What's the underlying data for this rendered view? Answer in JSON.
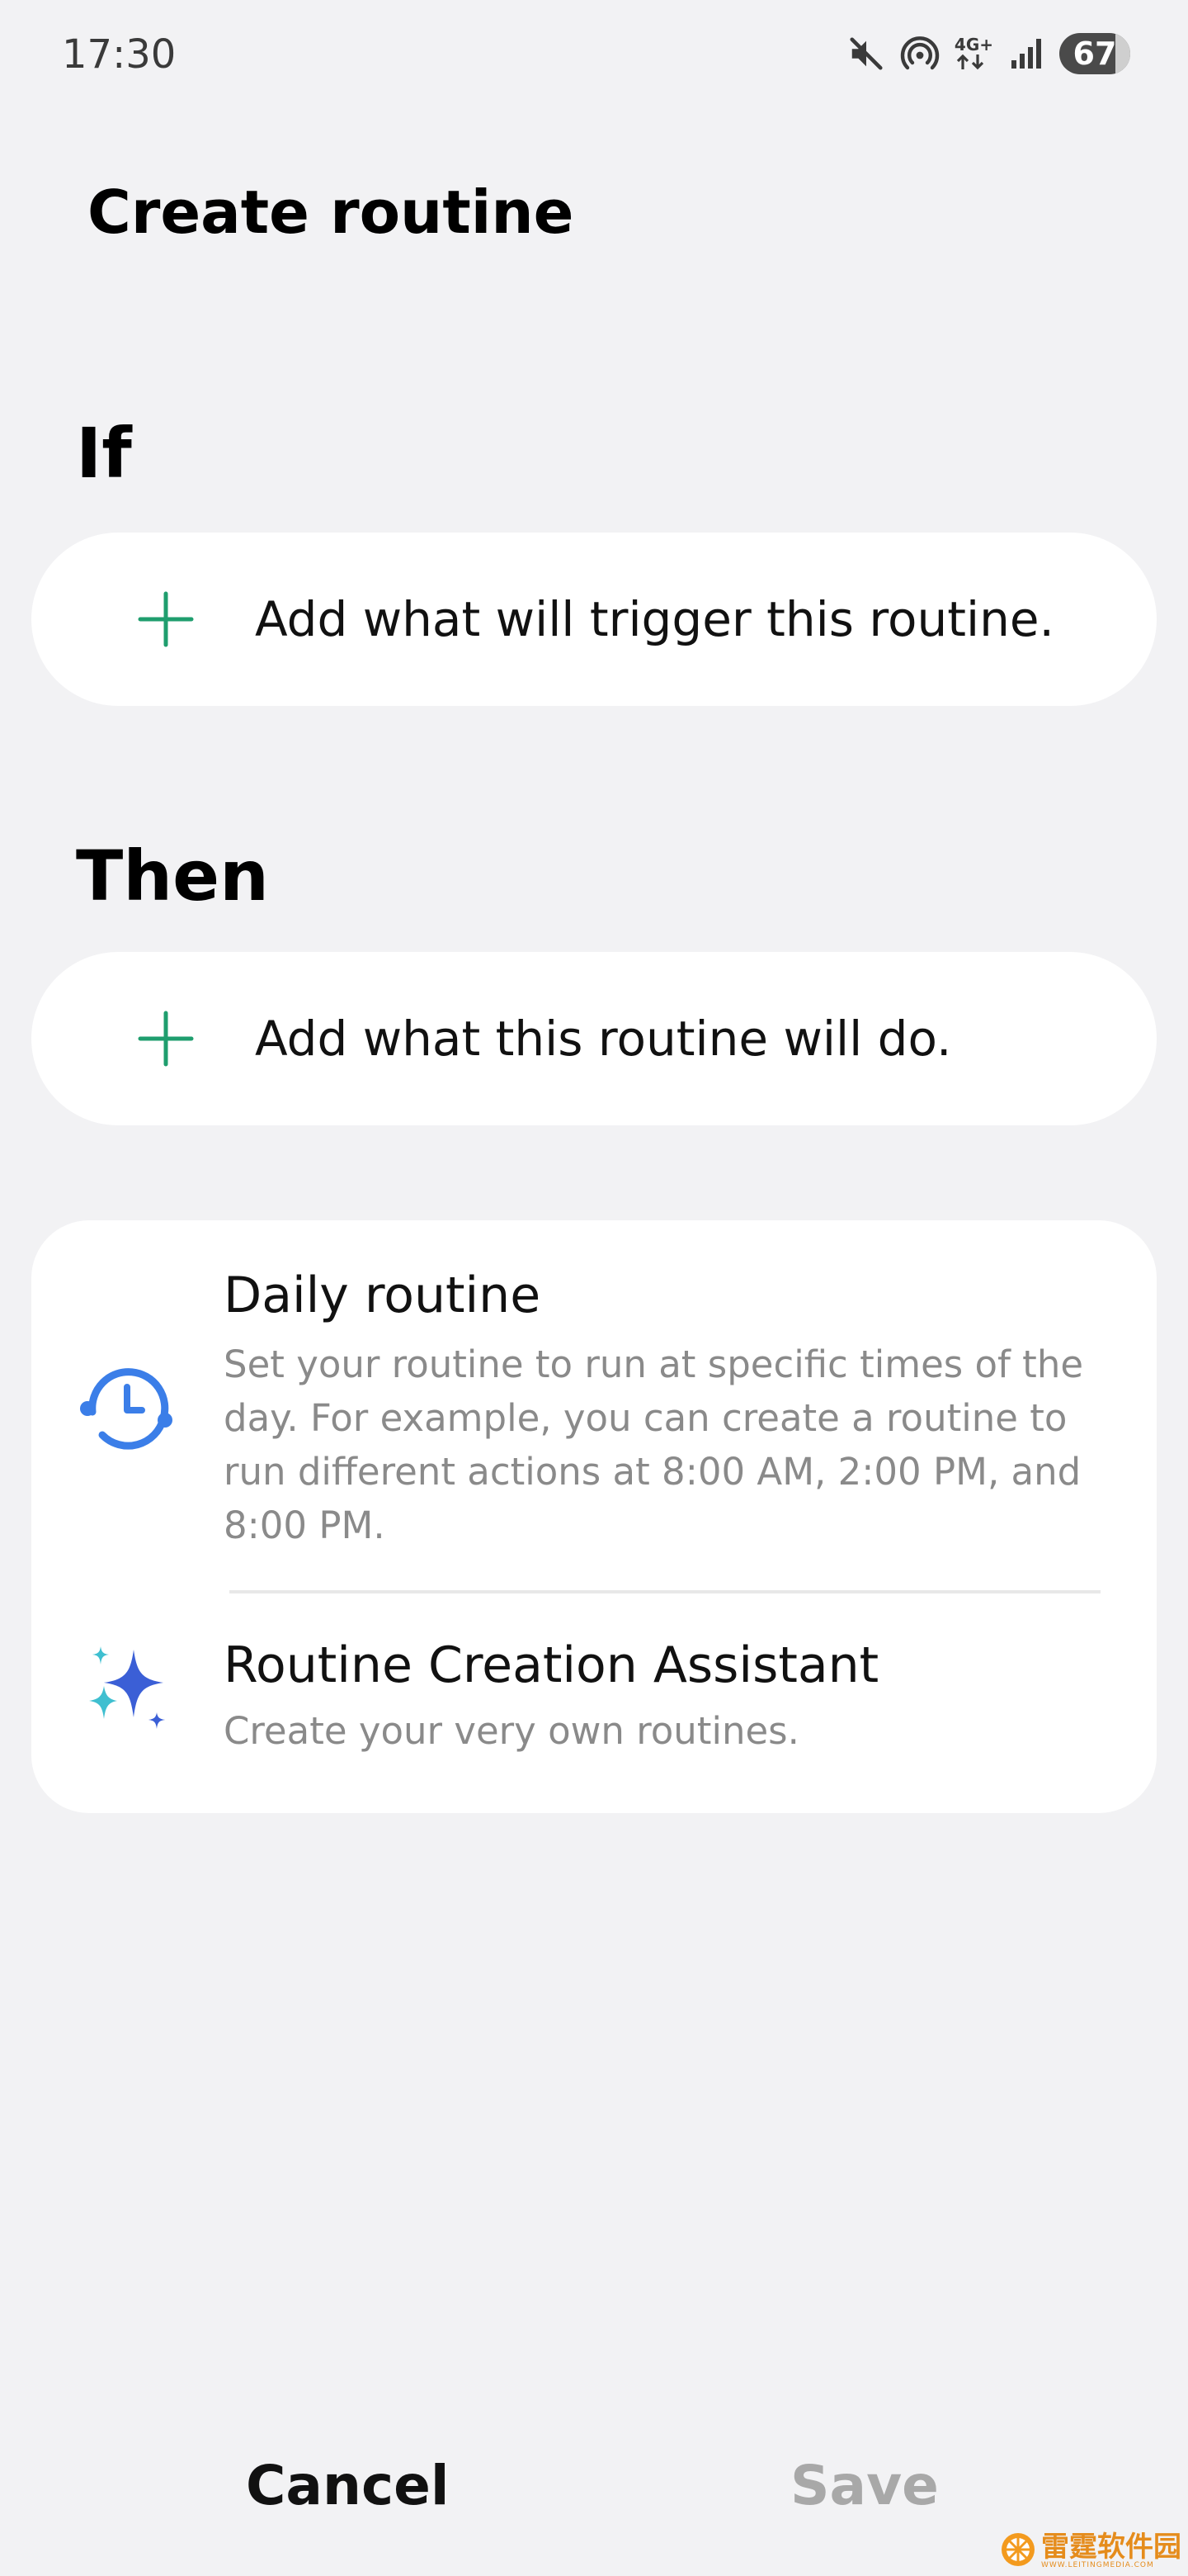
{
  "status_bar": {
    "time": "17:30",
    "network": "4G+",
    "battery": "67"
  },
  "page": {
    "title": "Create routine"
  },
  "if_section": {
    "heading": "If",
    "add_label": "Add what will trigger this routine."
  },
  "then_section": {
    "heading": "Then",
    "add_label": "Add what this routine will do."
  },
  "suggestions": {
    "daily": {
      "title": "Daily routine",
      "description": "Set your routine to run at specific times of the day. For example, you can create a routine to run different actions at 8:00 AM, 2:00 PM, and 8:00 PM."
    },
    "assistant": {
      "title": "Routine Creation Assistant",
      "description": "Create your very own routines."
    }
  },
  "footer": {
    "cancel_label": "Cancel",
    "save_label": "Save"
  },
  "watermark": {
    "text": "雷霆软件园",
    "subtext": "WWW.LEITINGMEDIA.COM"
  },
  "colors": {
    "background": "#f2f2f4",
    "card": "#ffffff",
    "accent_green": "#1f9e6e",
    "accent_blue": "#3b7ee8",
    "secondary_text": "#8a8a8a",
    "disabled": "#a8a8a8"
  },
  "icons": {
    "mute": "mute-icon",
    "hotspot": "hotspot-icon",
    "signal": "signal-icon",
    "add": "plus-icon",
    "clock": "clock-cycle-icon",
    "sparkle": "sparkle-icon"
  }
}
